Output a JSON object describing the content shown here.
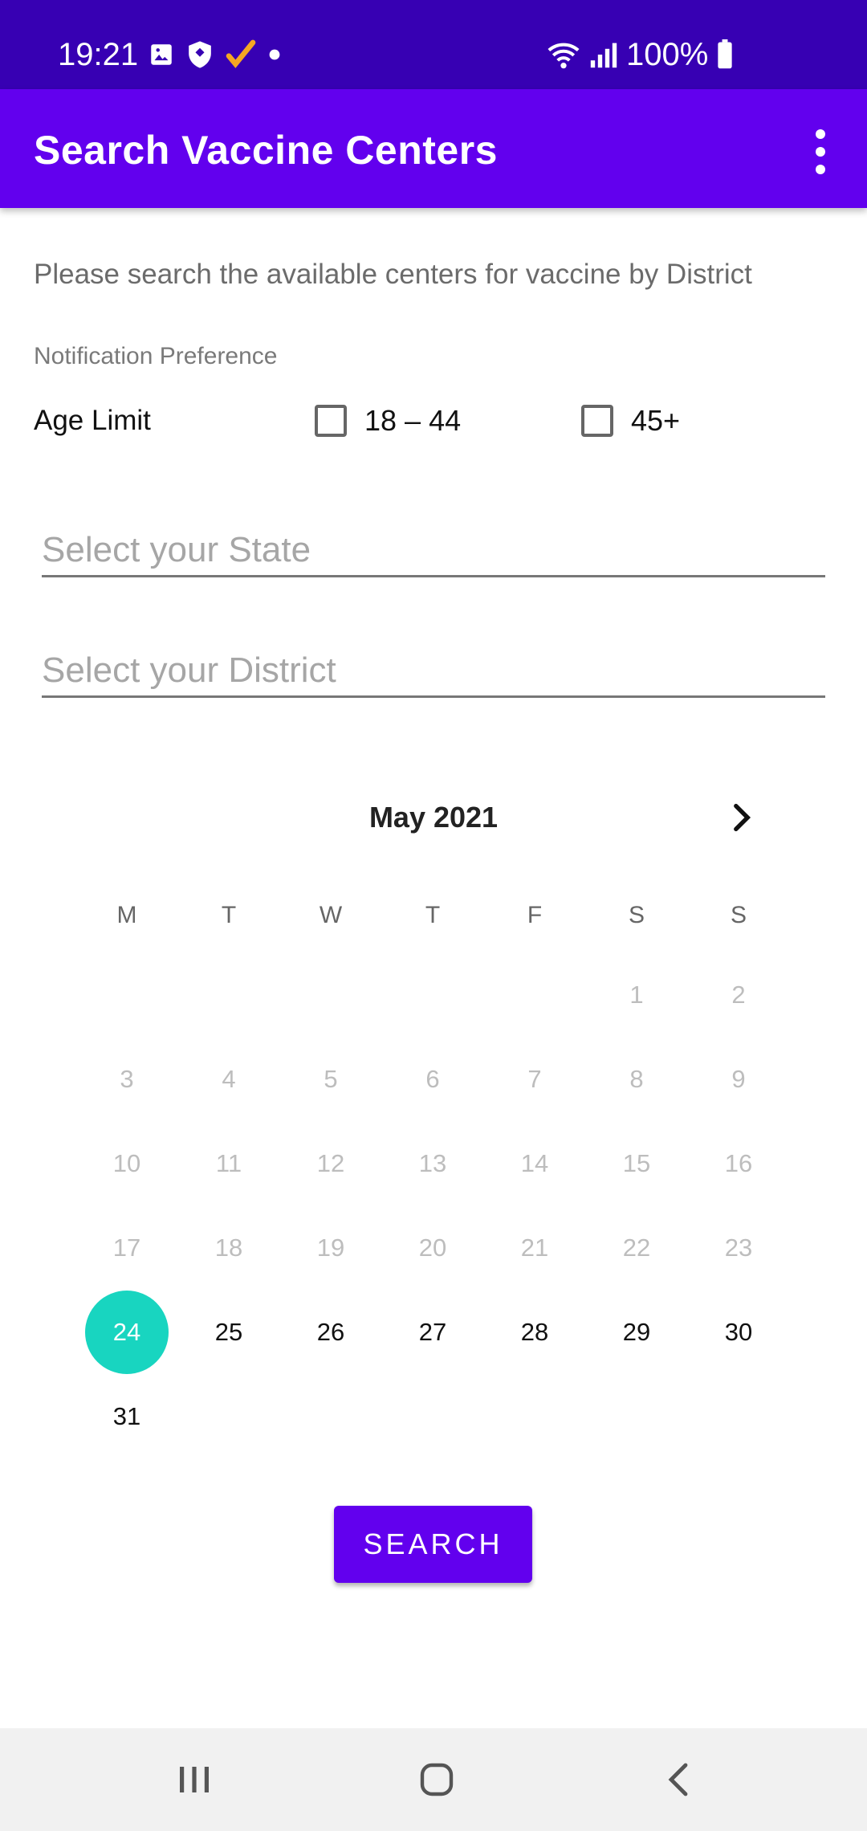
{
  "status_bar": {
    "time": "19:21",
    "battery": "100%",
    "icons": [
      "image-icon",
      "shield-icon",
      "checkmark-icon",
      "dot-icon",
      "wifi-icon",
      "signal-icon",
      "battery-icon"
    ],
    "colors": {
      "background": "#3700b3",
      "check": "#f5a623"
    }
  },
  "app_bar": {
    "title": "Search Vaccine Centers",
    "overflow_icon": "more-vert-icon",
    "color": "#6200ee"
  },
  "form": {
    "description": "Please search the available centers for vaccine by District",
    "notification_label": "Notification Preference",
    "age_limit_label": "Age Limit",
    "age_options": [
      {
        "label": "18 – 44",
        "checked": false
      },
      {
        "label": "45+",
        "checked": false
      }
    ],
    "state_placeholder": "Select your State",
    "district_placeholder": "Select your District"
  },
  "calendar": {
    "month_label": "May 2021",
    "weekdays": [
      "M",
      "T",
      "W",
      "T",
      "F",
      "S",
      "S"
    ],
    "first_weekday_index": 5,
    "days_in_month": 31,
    "selected_day": 24,
    "enabled_from": 24,
    "selected_color": "#18d5c0"
  },
  "search_button": {
    "label": "SEARCH"
  },
  "nav_bar": {
    "icons": [
      "recents-icon",
      "home-icon",
      "back-icon"
    ]
  }
}
